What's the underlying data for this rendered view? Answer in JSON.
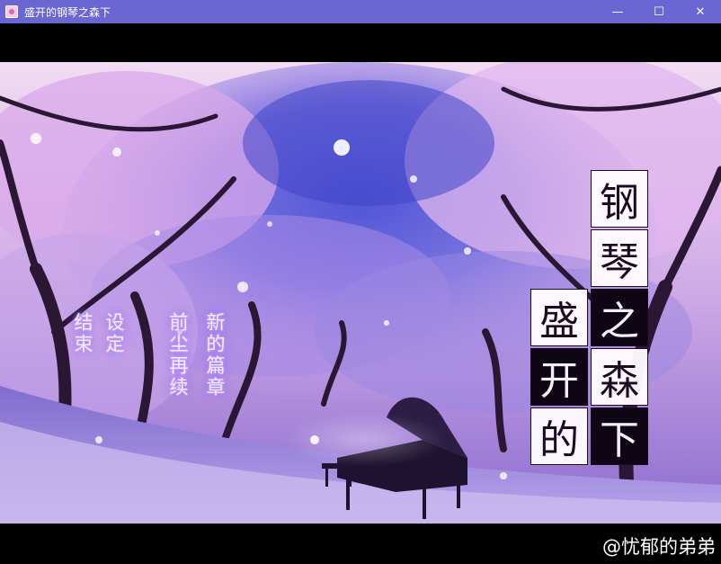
{
  "window": {
    "title": "盛开的钢琴之森下",
    "controls": {
      "minimize": "—",
      "maximize": "☐",
      "close": "✕"
    }
  },
  "menu": {
    "new_chapter": "新的篇章",
    "continue": "前尘再续",
    "settings": "设定",
    "exit": "结束"
  },
  "logo": {
    "col_right": [
      "钢",
      "琴",
      "之",
      "森",
      "下"
    ],
    "col_left": [
      "盛",
      "开",
      "的"
    ]
  },
  "watermark": "@忧郁的弟弟",
  "colors": {
    "titlebar": "#6a66d2",
    "sky": "#e9d4f2",
    "blossom": "#c48ae0",
    "canopy_blue": "#5b5ad8",
    "trunk": "#2a1734"
  }
}
